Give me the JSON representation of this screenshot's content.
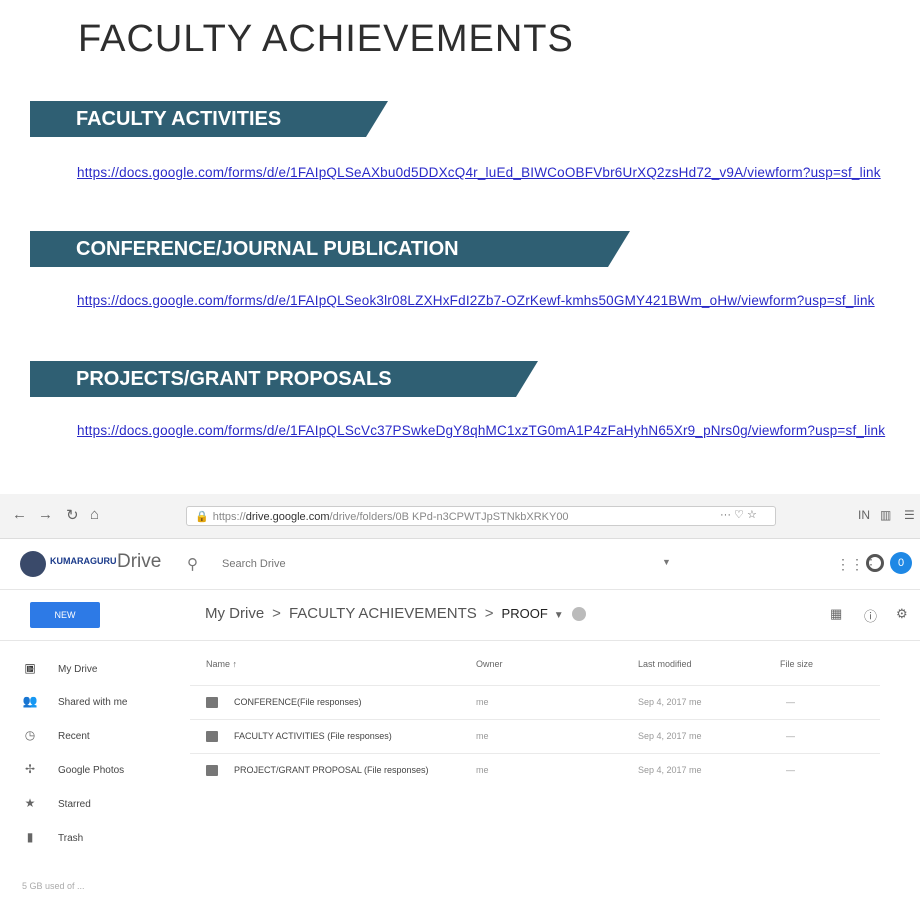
{
  "slide": {
    "title": "FACULTY ACHIEVEMENTS",
    "sections": [
      {
        "heading": "FACULTY ACTIVITIES",
        "link": "https://docs.google.com/forms/d/e/1FAIpQLSeAXbu0d5DDXcQ4r_luEd_BIWCoOBFVbr6UrXQ2zsHd72_v9A/viewform?usp=sf_link"
      },
      {
        "heading": "CONFERENCE/JOURNAL PUBLICATION",
        "link": "https://docs.google.com/forms/d/e/1FAIpQLSeok3lr08LZXHxFdI2Zb7-OZrKewf-kmhs50GMY421BWm_oHw/viewform?usp=sf_link"
      },
      {
        "heading": "PROJECTS/GRANT PROPOSALS",
        "link": "https://docs.google.com/forms/d/e/1FAIpQLScVc37PSwkeDgY8qhMC1xzTG0mA1P4zFaHyhN65Xr9_pNrs0g/viewform?usp=sf_link"
      }
    ]
  },
  "browser": {
    "url_prefix": "https://",
    "url_host": "drive.google.com",
    "url_path": "/drive/folders/0B KPd-n3CPWTJpSTNkbXRKY00",
    "url_actions": "··· ♡ ☆",
    "toolbar_right": [
      "IN",
      "▥",
      "☰"
    ]
  },
  "drive": {
    "brand_small": "KUMARAGURU",
    "app_name": "Drive",
    "search_placeholder": "Search Drive",
    "new_button": "NEW",
    "breadcrumb": [
      "My Drive",
      "FACULTY ACHIEVEMENTS",
      "PROOF"
    ],
    "avatar_letter": "0",
    "sidebar": [
      "My Drive",
      "Shared with me",
      "Recent",
      "Google Photos",
      "Starred",
      "Trash"
    ],
    "storage_text": "5 GB used of ...",
    "columns": {
      "name": "Name ↑",
      "owner": "Owner",
      "modified": "Last modified",
      "size": "File size"
    },
    "files": [
      {
        "name": "CONFERENCE(File responses)",
        "owner": "me",
        "modified": "Sep 4, 2017 me",
        "size": "—"
      },
      {
        "name": "FACULTY ACTIVITIES (File responses)",
        "owner": "me",
        "modified": "Sep 4, 2017 me",
        "size": "—"
      },
      {
        "name": "PROJECT/GRANT PROPOSAL (File responses)",
        "owner": "me",
        "modified": "Sep 4, 2017 me",
        "size": "—"
      }
    ]
  },
  "colors": {
    "banner": "#2f5f73",
    "link": "#2a2ac8",
    "new_button": "#2d7ae6",
    "avatar": "#1e88e5"
  }
}
